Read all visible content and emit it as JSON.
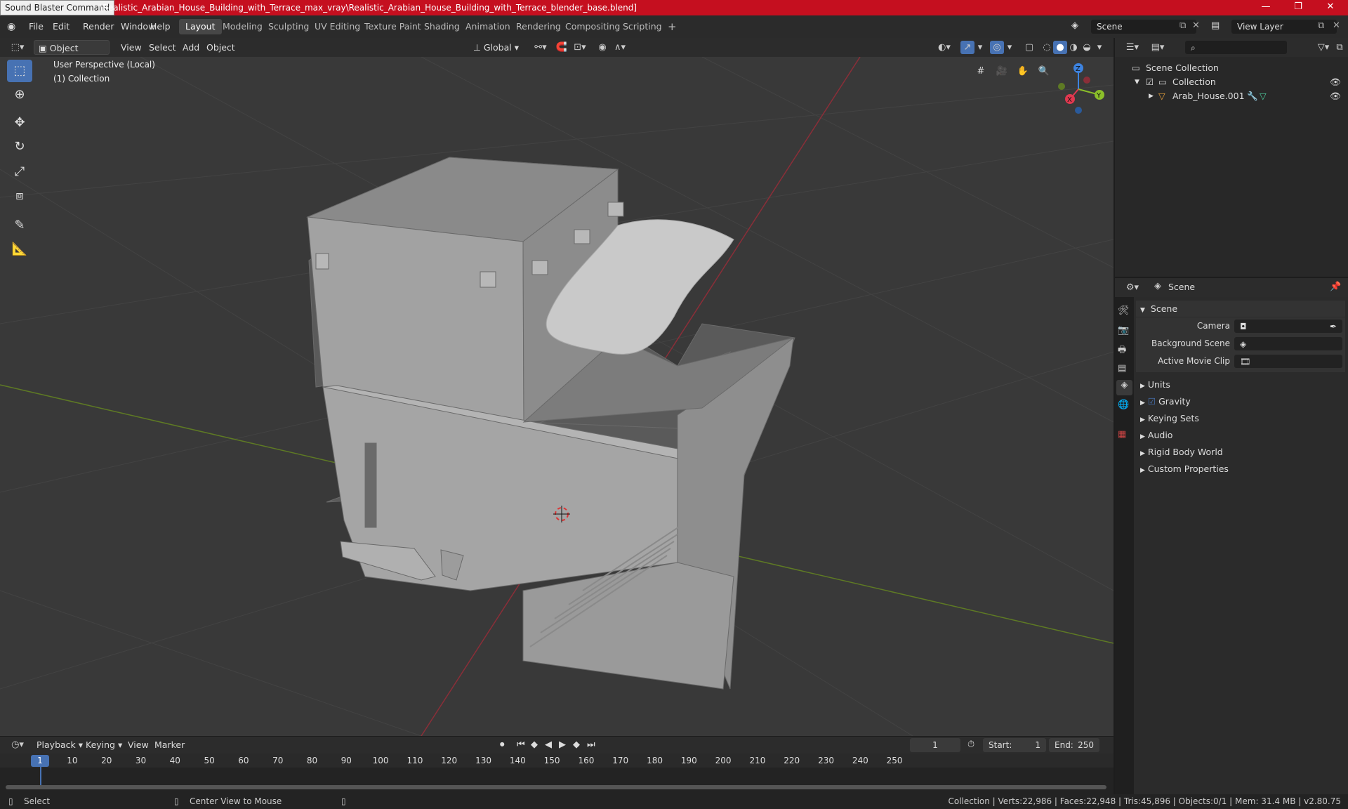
{
  "titlebar": {
    "tooltip": "Sound Blaster Command",
    "path": "\\Realistic_Arabian_House_Building_with_Terrace_max_vray\\Realistic_Arabian_House_Building_with_Terrace_blender_base.blend]",
    "minimize": "—",
    "restore": "❐",
    "close": "✕"
  },
  "menu": [
    "File",
    "Edit",
    "Render",
    "Window",
    "Help"
  ],
  "workspaces": [
    "Layout",
    "Modeling",
    "Sculpting",
    "UV Editing",
    "Texture Paint",
    "Shading",
    "Animation",
    "Rendering",
    "Compositing",
    "Scripting"
  ],
  "scene_field": "Scene",
  "view_layer_field": "View Layer",
  "viewport_header": {
    "mode": "Object Mode",
    "view": "View",
    "select": "Select",
    "add": "Add",
    "object": "Object",
    "orientation": "Global"
  },
  "overlay_text": {
    "line1": "User Perspective (Local)",
    "line2": "(1) Collection"
  },
  "gizmo": {
    "z": "Z",
    "y": "Y",
    "x": "X",
    "colors": {
      "x": "#e0384f",
      "y": "#8bbf2a",
      "z": "#3d83e0"
    }
  },
  "outliner": {
    "root": "Scene Collection",
    "collection": "Collection",
    "object": "Arab_House.001"
  },
  "properties": {
    "header": "Scene",
    "section": "Scene",
    "camera_label": "Camera",
    "background_scene_label": "Background Scene",
    "active_movie_clip_label": "Active Movie Clip",
    "panels": [
      "Units",
      "Gravity",
      "Keying Sets",
      "Audio",
      "Rigid Body World",
      "Custom Properties"
    ]
  },
  "timeline": {
    "playback": "Playback",
    "keying": "Keying",
    "view": "View",
    "marker": "Marker",
    "current_frame": "1",
    "start_label": "Start:",
    "start": "1",
    "end_label": "End:",
    "end": "250",
    "ticks": [
      "1",
      "10",
      "20",
      "30",
      "40",
      "50",
      "60",
      "70",
      "80",
      "90",
      "100",
      "110",
      "120",
      "130",
      "140",
      "150",
      "160",
      "170",
      "180",
      "190",
      "200",
      "210",
      "220",
      "230",
      "240",
      "250"
    ]
  },
  "status": {
    "select": "Select",
    "center": "Center View to Mouse",
    "info": "Collection | Verts:22,986 | Faces:22,948 | Tris:45,896 | Objects:0/1 | Mem: 31.4 MB | v2.80.75"
  },
  "colors": {
    "accent": "#4772b3",
    "title_red": "#c50f1f",
    "viewport_bg": "#393939"
  }
}
